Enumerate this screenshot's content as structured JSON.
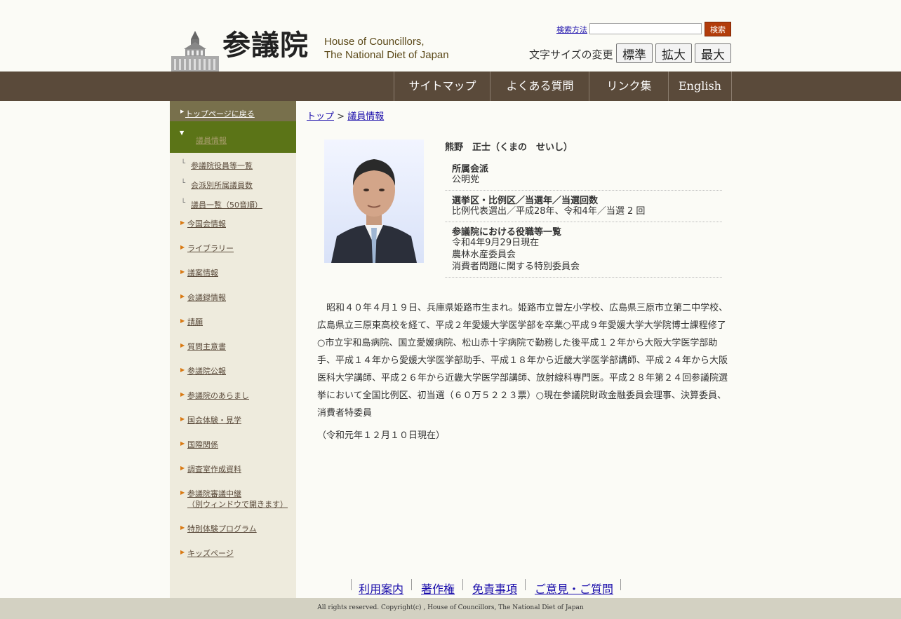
{
  "header": {
    "logo_kanji": "参議院",
    "logo_en_line1": "House of Councillors,",
    "logo_en_line2": "The National Diet of Japan",
    "search_method": "検索方法",
    "search_button": "検索",
    "fontsize_label": "文字サイズの変更",
    "fontsize_buttons": [
      "標準",
      "拡大",
      "最大"
    ]
  },
  "nav": {
    "items": [
      "サイトマップ",
      "よくある質問",
      "リンク集",
      "English"
    ]
  },
  "sidebar": {
    "top_link": "トップページに戻る",
    "active": "議員情報",
    "sub_items": [
      "参議院役員等一覧",
      "会派別所属議員数",
      "議員一覧（50音順）"
    ],
    "items": [
      "今国会情報",
      "ライブラリー",
      "議案情報",
      "会議録情報",
      "請願",
      "質問主意書",
      "参議院公報",
      "参議院のあらまし",
      "国会体験・見学",
      "国際関係",
      "調査室作成資料",
      "参議院審議中継",
      "特別体験プログラム",
      "キッズページ"
    ],
    "broadcast_note": "（別ウィンドウで開きます）"
  },
  "breadcrumb": {
    "top": "トップ",
    "sep": ">",
    "current": "議員情報"
  },
  "member": {
    "name": "熊野　正士（くまの　せいし）",
    "faction_label": "所属会派",
    "faction": "公明党",
    "district_label": "選挙区・比例区／当選年／当選回数",
    "district": "比例代表選出／平成28年、令和4年／当選 2 回",
    "roles_label": "参議院における役職等一覧",
    "roles_date": "令和4年9月29日現在",
    "roles": [
      "農林水産委員会",
      "消費者問題に関する特別委員会"
    ],
    "bio": "　昭和４０年４月１９日、兵庫県姫路市生まれ。姫路市立曽左小学校、広島県三原市立第二中学校、広島県立三原東高校を経て、平成２年愛媛大学医学部を卒業○平成９年愛媛大学大学院博士課程修了○市立宇和島病院、国立愛媛病院、松山赤十字病院で勤務した後平成１２年から大阪大学医学部助手、平成１４年から愛媛大学医学部助手、平成１８年から近畿大学医学部講師、平成２４年から大阪医科大学講師、平成２６年から近畿大学医学部講師、放射線科専門医。平成２８年第２４回参議院選挙において全国比例区、初当選（６０万５２２３票）○現在参議院財政金融委員会理事、決算委員、消費者特委員",
    "as_of": "（令和元年１２月１０日現在）"
  },
  "footer": {
    "links": [
      "利用案内",
      "著作権",
      "免責事項",
      "ご意見・ご質問"
    ],
    "copyright": "All rights reserved. Copyright(c) , House of Councillors, The National Diet of Japan"
  },
  "colors": {
    "nav_bg": "#5a4a3a",
    "sidebar_bg": "#eeebdd",
    "sidebar_active": "#5b7417",
    "search_button": "#b23c0a"
  }
}
